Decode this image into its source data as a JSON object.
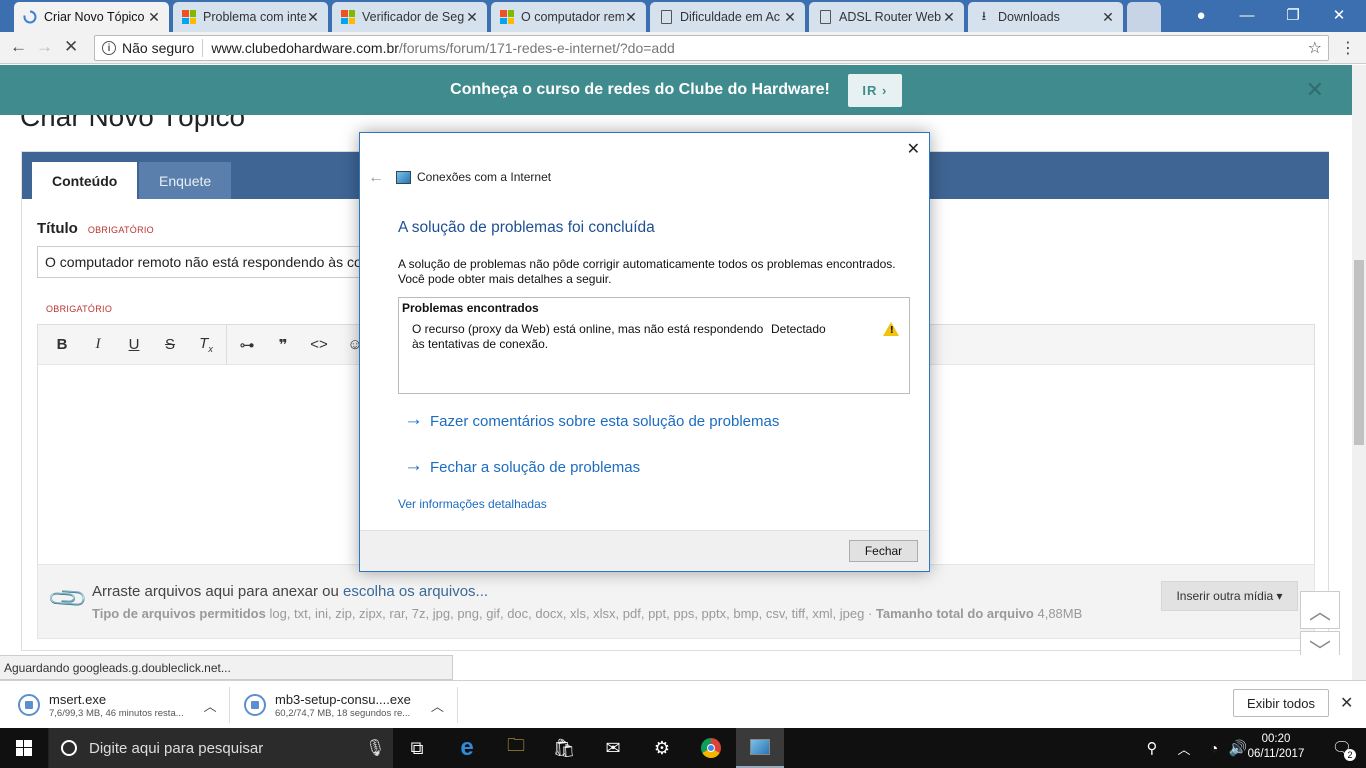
{
  "browser": {
    "tabs": [
      {
        "title": "Criar Novo Tópico",
        "icon": "loading-spinner-icon",
        "active": true
      },
      {
        "title": "Problema com inte",
        "icon": "microsoft-logo-icon"
      },
      {
        "title": "Verificador de Seg",
        "icon": "microsoft-logo-icon"
      },
      {
        "title": "O computador rem",
        "icon": "microsoft-logo-icon"
      },
      {
        "title": "Dificuldade em Ac",
        "icon": "document-icon"
      },
      {
        "title": "ADSL Router Web",
        "icon": "document-icon"
      },
      {
        "title": "Downloads",
        "icon": "download-icon"
      }
    ],
    "security_label": "Não seguro",
    "url_host": "www.clubedohardware.com.br",
    "url_path": "/forums/forum/171-redes-e-internet/?do=add"
  },
  "banner": {
    "text": "Conheça o curso de redes do Clube do Hardware!",
    "button": "IR"
  },
  "page": {
    "title": "Criar Novo Tópico",
    "tabs": [
      "Conteúdo",
      "Enquete"
    ],
    "title_label": "Título",
    "required_tag": "OBRIGATÓRIO",
    "title_value": "O computador remoto não está respondendo às co",
    "attach_text": "Arraste arquivos aqui para anexar ou ",
    "attach_link": "escolha os arquivos...",
    "allowed_label": "Tipo de arquivos permitidos",
    "allowed_types": "log, txt, ini, zip, zipx, rar, 7z, jpg, png, gif, doc, docx, xls, xlsx, pdf, ppt, pps, pptx, bmp, csv, tiff, xml, jpeg",
    "size_sep": " · ",
    "size_label": "Tamanho total do arquivo",
    "size_value": "4,88MB",
    "media_button": "Inserir outra mídia ▾"
  },
  "status_bar": "Aguardando googleads.g.doubleclick.net...",
  "downloads": [
    {
      "name": "msert.exe",
      "detail": "7,6/99,3 MB, 46 minutos resta..."
    },
    {
      "name": "mb3-setup-consu....exe",
      "detail": "60,2/74,7 MB, 18 segundos re..."
    }
  ],
  "show_all": "Exibir todos",
  "taskbar": {
    "search_placeholder": "Digite aqui para pesquisar",
    "time": "00:20",
    "date": "06/11/2017",
    "notifications": "2"
  },
  "dialog": {
    "breadcrumb": "Conexões com a Internet",
    "heading": "A solução de problemas foi concluída",
    "description": "A solução de problemas não pôde corrigir automaticamente todos os problemas encontrados. Você pode obter mais detalhes a seguir.",
    "list_header": "Problemas encontrados",
    "problem": "O recurso (proxy da Web) está online, mas não está respondendo às tentativas de conexão.",
    "problem_status": "Detectado",
    "link_feedback": "Fazer comentários sobre esta solução de problemas",
    "link_close": "Fechar a solução de problemas",
    "details_link": "Ver informações detalhadas",
    "close_button": "Fechar"
  }
}
